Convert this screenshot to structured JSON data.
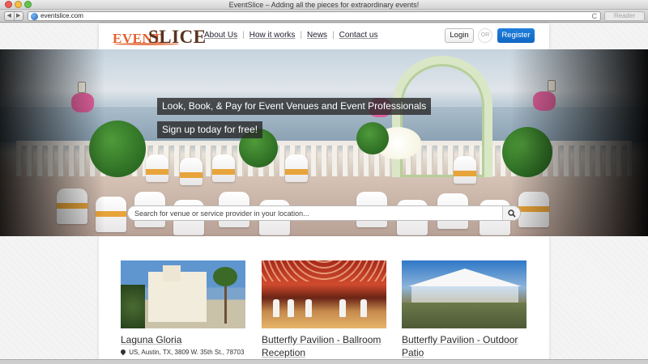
{
  "browser": {
    "window_title": "EventSlice – Adding all the pieces for extraordinary events!",
    "url": "eventslice.com",
    "reader_label": "Reader",
    "back_glyph": "◀",
    "forward_glyph": "▶",
    "reload_glyph": "C"
  },
  "header": {
    "logo_part1": "EVENT",
    "logo_part2": "SLICE",
    "nav": [
      "About Us",
      "How it works",
      "News",
      "Contact us"
    ],
    "login_label": "Login",
    "or_label": "OR",
    "register_label": "Register",
    "brand_colors": {
      "orange": "#e3612f",
      "brown": "#5a3320",
      "register_blue": "#1668c8"
    }
  },
  "hero": {
    "tagline_1": "Look, Book, & Pay for Event Venues and Event Professionals",
    "tagline_2": "Sign up today for free!",
    "search_placeholder": "Search for venue or service provider in your location...",
    "search_icon": "search-icon"
  },
  "listings": [
    {
      "title": "Laguna Gloria",
      "location": "US, Austin, TX, 3809 W. 35th St., 78703"
    },
    {
      "title": "Butterfly Pavilion - Ballroom Reception",
      "location": ""
    },
    {
      "title": "Butterfly Pavilion - Outdoor Patio",
      "location": ""
    }
  ]
}
